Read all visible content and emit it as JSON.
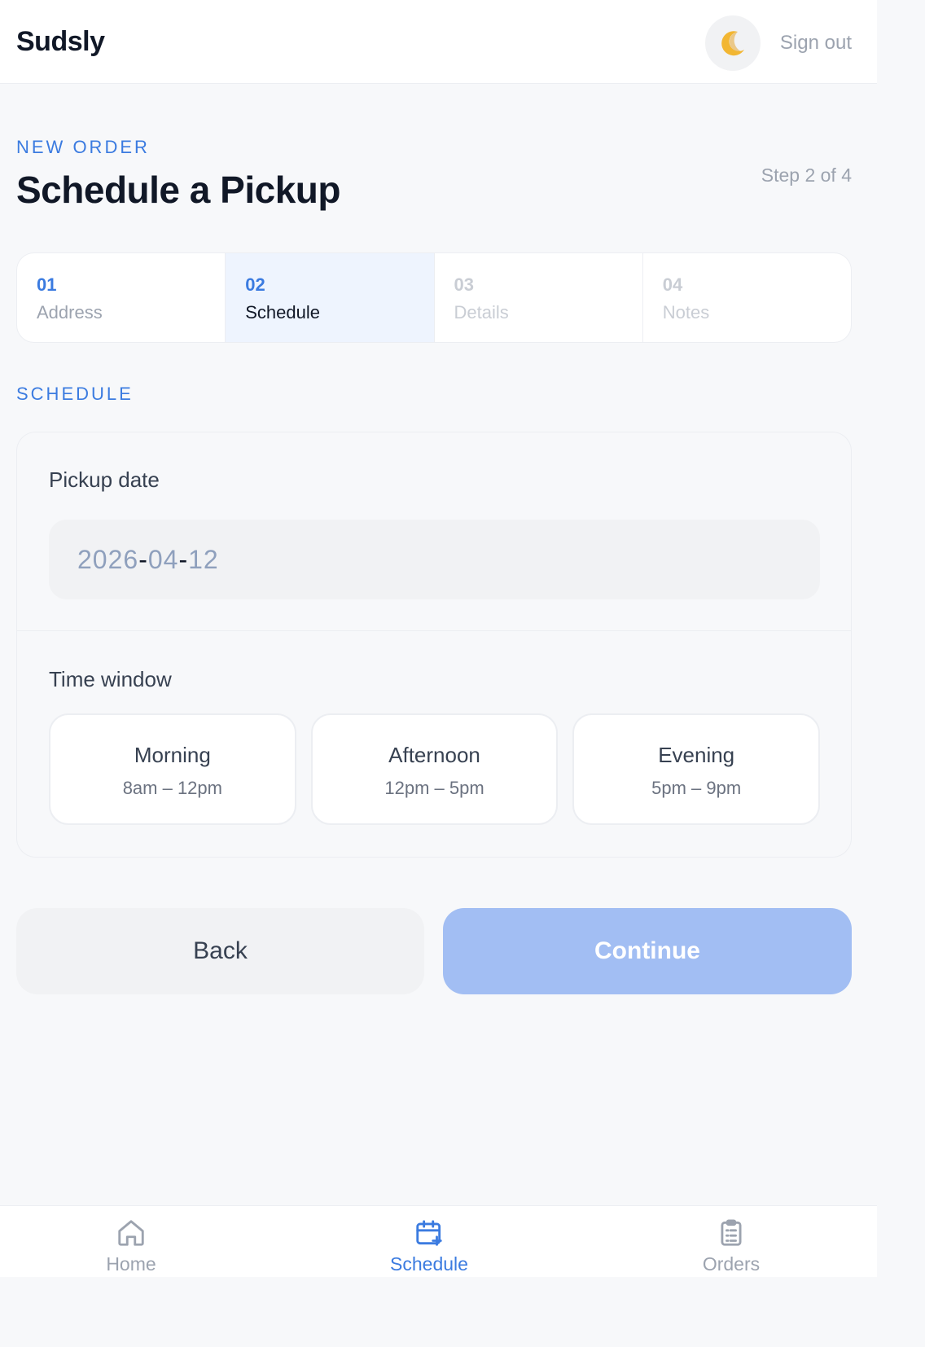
{
  "app": {
    "name": "Sudsly"
  },
  "header": {
    "theme_icon": "moon-icon",
    "sign_out": "Sign out"
  },
  "page": {
    "eyebrow": "NEW ORDER",
    "title": "Schedule a Pickup",
    "step_indicator": "Step 2 of 4"
  },
  "stepper": [
    {
      "num": "01",
      "label": "Address",
      "state": "done"
    },
    {
      "num": "02",
      "label": "Schedule",
      "state": "active"
    },
    {
      "num": "03",
      "label": "Details",
      "state": "todo"
    },
    {
      "num": "04",
      "label": "Notes",
      "state": "todo"
    }
  ],
  "schedule": {
    "section_label": "SCHEDULE",
    "pickup_date_label": "Pickup date",
    "date": {
      "year": "2026",
      "month": "04",
      "day": "12",
      "sep": "-"
    },
    "time_window_label": "Time window",
    "slots": [
      {
        "name": "Morning",
        "range": "8am – 12pm"
      },
      {
        "name": "Afternoon",
        "range": "12pm – 5pm"
      },
      {
        "name": "Evening",
        "range": "5pm – 9pm"
      }
    ]
  },
  "actions": {
    "back": "Back",
    "continue": "Continue"
  },
  "tabbar": [
    {
      "label": "Home",
      "icon": "home-icon"
    },
    {
      "label": "Schedule",
      "icon": "calendar-plus-icon",
      "active": true
    },
    {
      "label": "Orders",
      "icon": "clipboard-list-icon"
    }
  ],
  "colors": {
    "accent": "#3b7be0",
    "continue_disabled": "#a2bef3",
    "background": "#f7f8fa"
  }
}
